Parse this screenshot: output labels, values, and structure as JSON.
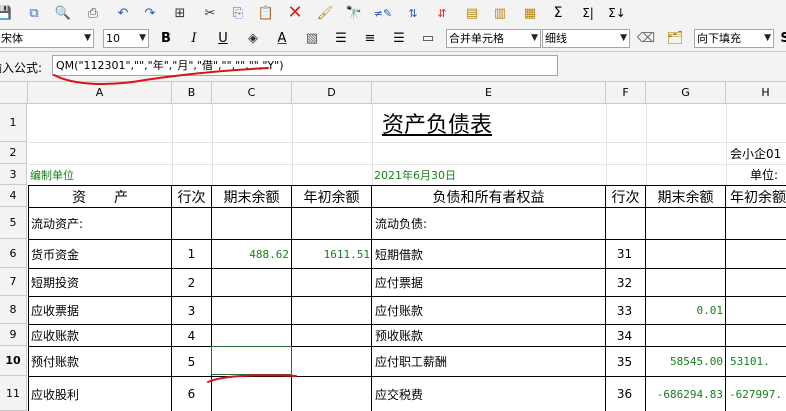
{
  "toolbar": {
    "icons": [
      "save-icon",
      "copy-sheet-icon",
      "print-preview-icon",
      "print-icon",
      "undo-icon",
      "redo-icon",
      "select-all-icon",
      "cut-icon",
      "copy-icon",
      "paste-icon",
      "delete-icon",
      "format-brush-icon",
      "find-icon",
      "replace-icon",
      "sort-ascending-icon",
      "sort-descending-icon",
      "insert-row-icon",
      "insert-column-icon",
      "insert-sheet-icon",
      "sum-icon",
      "sum-row-icon",
      "sum-column-icon"
    ],
    "font_name": "宋体",
    "font_size": "10",
    "bold_label": "B",
    "italic_label": "I",
    "underline_label": "U",
    "font_color_label": "A",
    "merge_label": "合并单元格",
    "border_label": "细线",
    "fill_label": "向下填充",
    "style_label": "S"
  },
  "formula": {
    "label": "输入公式:",
    "value": "QM(\"112301\",\"\",\"年\",\"月\",\"借\",\"\",\"\",\"\",\"Y\")"
  },
  "columns": [
    "A",
    "B",
    "C",
    "D",
    "E",
    "F",
    "G",
    "H"
  ],
  "rows": [
    "1",
    "2",
    "3",
    "4",
    "5",
    "6",
    "7",
    "8",
    "9",
    "10",
    "11"
  ],
  "sheet": {
    "title": "资产负债表",
    "r2_h": "会小企01",
    "r3_a": "编制单位",
    "r3_e": "2021年6月30日",
    "r3_h": "单位:",
    "hdr_a": "资　　产",
    "hdr_b": "行次",
    "hdr_c": "期末余额",
    "hdr_d": "年初余额",
    "hdr_e": "负债和所有者权益",
    "hdr_f": "行次",
    "hdr_g": "期末余额",
    "hdr_h": "年初余额",
    "r5_a": "流动资产:",
    "r5_e": "流动负债:",
    "r6_a": "货币资金",
    "r6_b": "1",
    "r6_c": "488.62",
    "r6_d": "1611.51",
    "r6_e": "短期借款",
    "r6_f": "31",
    "r7_a": "短期投资",
    "r7_b": "2",
    "r7_e": "应付票据",
    "r7_f": "32",
    "r8_a": "应收票据",
    "r8_b": "3",
    "r8_e": "应付账款",
    "r8_f": "33",
    "r8_g": "0.01",
    "r9_a": "应收账款",
    "r9_b": "4",
    "r9_e": "预收账款",
    "r9_f": "34",
    "r10_a": "预付账款",
    "r10_b": "5",
    "r10_e": "应付职工薪酬",
    "r10_f": "35",
    "r10_g": "58545.00",
    "r10_h": "53101.",
    "r11_a": "应收股利",
    "r11_b": "6",
    "r11_e": "应交税费",
    "r11_f": "36",
    "r11_g": "-686294.83",
    "r11_h": "-627997."
  },
  "colors": {
    "value_green": "#17801c",
    "annotation_red": "#d8141b",
    "selection_border": "#2d6a3a"
  }
}
